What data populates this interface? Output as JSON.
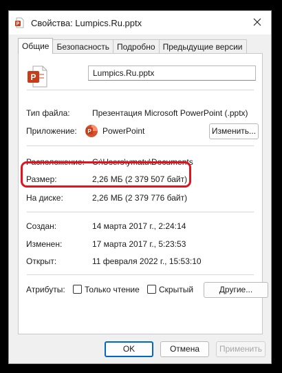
{
  "window": {
    "title": "Свойства: Lumpics.Ru.pptx"
  },
  "tabs": [
    {
      "label": "Общие",
      "active": true
    },
    {
      "label": "Безопасность",
      "active": false
    },
    {
      "label": "Подробно",
      "active": false
    },
    {
      "label": "Предыдущие версии",
      "active": false
    }
  ],
  "general": {
    "filename": "Lumpics.Ru.pptx",
    "file_type_label": "Тип файла:",
    "file_type_value": "Презентация Microsoft PowerPoint (.pptx)",
    "app_label": "Приложение:",
    "app_value": "PowerPoint",
    "change_button": "Изменить...",
    "location_label": "Расположение:",
    "location_value": "C:\\Users\\ymatu\\Documents",
    "size_label": "Размер:",
    "size_value": "2,26 МБ (2 379 507 байт)",
    "disk_label": "На диске:",
    "disk_value": "2,26 МБ (2 379 776 байт)",
    "created_label": "Создан:",
    "created_value": "14 марта 2017 г., 2:24:14",
    "modified_label": "Изменен:",
    "modified_value": "17 марта 2017 г., 5:23:53",
    "opened_label": "Открыт:",
    "opened_value": "11 февраля 2022 г., 15:53:10",
    "attributes_label": "Атрибуты:",
    "readonly_label": "Только чтение",
    "readonly_checked": false,
    "hidden_label": "Скрытый",
    "hidden_checked": false,
    "other_button": "Другие..."
  },
  "footer": {
    "ok": "OK",
    "cancel": "Отмена",
    "apply": "Применить"
  },
  "colors": {
    "highlight": "#e0141e",
    "powerpoint": "#c43e1c",
    "primary_border": "#0067c0"
  },
  "icons": {
    "title": "pptx-file-icon",
    "close": "close-icon",
    "file": "pptx-file-icon",
    "app": "powerpoint-app-icon"
  }
}
